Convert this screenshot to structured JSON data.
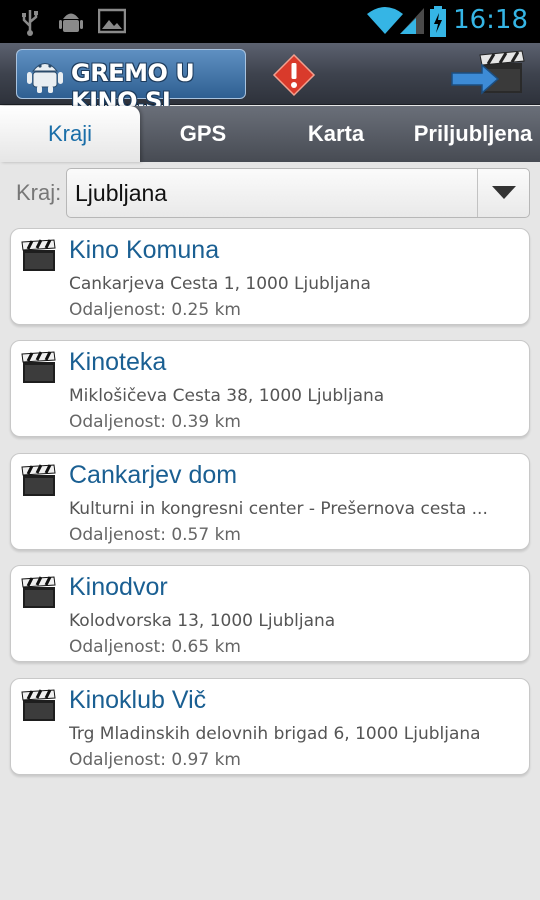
{
  "status_bar": {
    "time": "16:18",
    "icons": [
      "usb-icon",
      "android-debug-icon",
      "image-icon",
      "wifi-icon",
      "signal-icon",
      "battery-charging-icon"
    ]
  },
  "header": {
    "logo_text": "GREMO U KINO.SI",
    "alert_icon": "warning-icon",
    "action_icon": "arrow-clapperboard-icon"
  },
  "tabs": [
    {
      "label": "Kraji",
      "active": true
    },
    {
      "label": "GPS",
      "active": false
    },
    {
      "label": "Karta",
      "active": false
    },
    {
      "label": "Priljubljena",
      "active": false
    }
  ],
  "filter": {
    "label": "Kraj:",
    "value": "Ljubljana"
  },
  "cinemas": [
    {
      "name": "Kino Komuna",
      "address": "Cankarjeva Cesta 1, 1000 Ljubljana",
      "distance": "Odaljenost: 0.25 km"
    },
    {
      "name": "Kinoteka",
      "address": "Miklošičeva Cesta 38, 1000 Ljubljana",
      "distance": "Odaljenost: 0.39 km"
    },
    {
      "name": "Cankarjev dom",
      "address": "Kulturni in kongresni center - Prešernova cesta ...",
      "distance": "Odaljenost: 0.57 km"
    },
    {
      "name": "Kinodvor",
      "address": "Kolodvorska 13, 1000 Ljubljana",
      "distance": "Odaljenost: 0.65 km"
    },
    {
      "name": "Kinoklub Vič",
      "address": "Trg Mladinskih delovnih brigad 6, 1000 Ljubljana",
      "distance": "Odaljenost: 0.97 km"
    }
  ],
  "colors": {
    "accent_blue": "#1a5f92",
    "status_time": "#35b5e5",
    "warning_red": "#d93a2b"
  }
}
